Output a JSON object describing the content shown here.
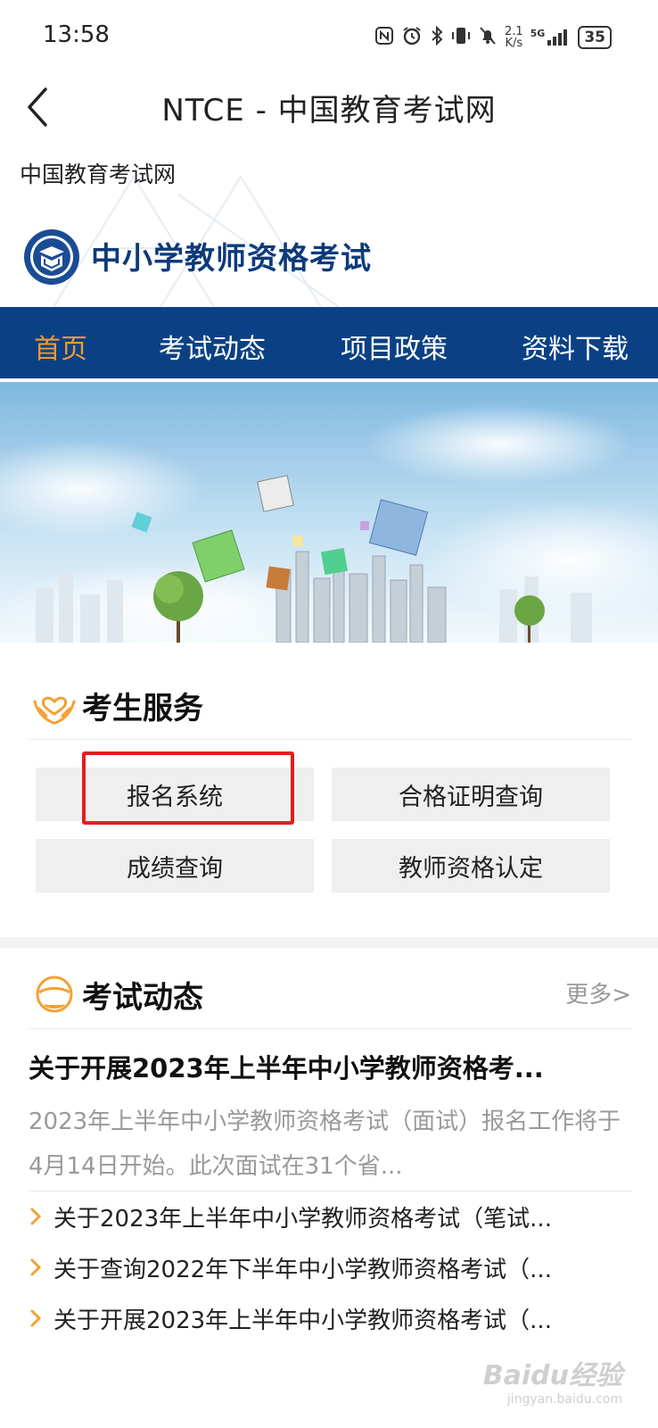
{
  "status_bar": {
    "time": "13:58",
    "network_speed_value": "2.1",
    "network_speed_unit": "K/s",
    "signal": "5G",
    "battery": "35",
    "icons": [
      "nfc-icon",
      "alarm-icon",
      "bluetooth-icon",
      "vibrate-icon",
      "mute-icon",
      "signal-icon",
      "battery-icon"
    ]
  },
  "title_bar": {
    "title": "NTCE - 中国教育考试网"
  },
  "site_header": {
    "small_title": "中国教育考试网",
    "site_name": "中小学教师资格考试"
  },
  "nav": {
    "items": [
      {
        "label": "首页",
        "active": true
      },
      {
        "label": "考试动态",
        "active": false
      },
      {
        "label": "项目政策",
        "active": false
      },
      {
        "label": "资料下载",
        "active": false
      }
    ]
  },
  "services": {
    "title": "考生服务",
    "buttons": [
      "报名系统",
      "合格证明查询",
      "成绩查询",
      "教师资格认定"
    ],
    "highlighted": "报名系统"
  },
  "news": {
    "title": "考试动态",
    "more": "更多>",
    "headline": "关于开展2023年上半年中小学教师资格考...",
    "summary": "2023年上半年中小学教师资格考试（面试）报名工作将于4月14日开始。此次面试在31个省...",
    "items": [
      "关于2023年上半年中小学教师资格考试（笔试...",
      "关于查询2022年下半年中小学教师资格考试（...",
      "关于开展2023年上半年中小学教师资格考试（..."
    ]
  },
  "watermark": {
    "text": "Baidu经验",
    "sub": "jingyan.baidu.com"
  },
  "colors": {
    "nav_bg": "#0b4184",
    "nav_active": "#f09a36",
    "brand_text": "#0d3a7a",
    "highlight": "#e01e1e",
    "accent_orange": "#f3a132"
  }
}
